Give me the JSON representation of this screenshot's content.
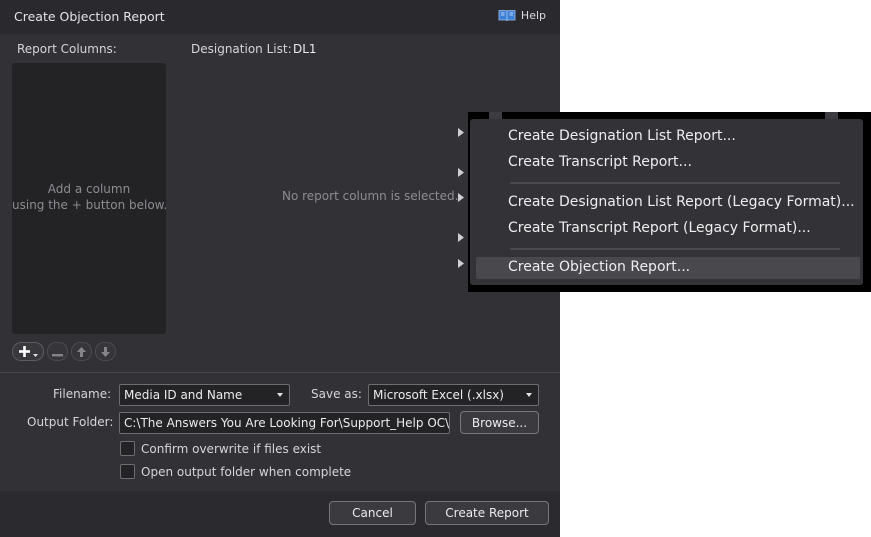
{
  "dialog": {
    "title": "Create Objection Report",
    "help_label": "Help",
    "report_columns_label": "Report Columns:",
    "designation_list_label": "Designation List:",
    "designation_list_value": "DL1",
    "columns_hint_line1": "Add a column",
    "columns_hint_line2": "using the + button below.",
    "no_column_message": "No report column is selected."
  },
  "options": {
    "filename_label": "Filename:",
    "filename_value": "Media ID and Name",
    "save_as_label": "Save as:",
    "save_as_value": "Microsoft Excel (.xlsx)",
    "output_folder_label": "Output Folder:",
    "output_folder_value": "C:\\The Answers You Are Looking For\\Support_Help OC\\_reports",
    "browse_label": "Browse...",
    "confirm_overwrite_label": "Confirm overwrite if files exist",
    "confirm_overwrite_checked": false,
    "open_folder_label": "Open output folder when complete",
    "open_folder_checked": false
  },
  "footer": {
    "cancel_label": "Cancel",
    "create_label": "Create Report"
  },
  "context_menu": {
    "items": [
      {
        "label": "Create Designation List Report..."
      },
      {
        "label": "Create Transcript Report..."
      },
      {
        "label": "Create Designation List Report (Legacy Format)..."
      },
      {
        "label": "Create Transcript Report  (Legacy Format)..."
      },
      {
        "label": "Create Objection Report...",
        "highlighted": true
      }
    ]
  },
  "icons": {
    "help": "book-icon",
    "add": "plus-icon",
    "remove": "minus-icon",
    "move_up": "arrow-up-icon",
    "move_down": "arrow-down-icon",
    "submenu": "chevron-right-icon"
  },
  "colors": {
    "dialog_bg": "#323236",
    "panel_bg": "#232326",
    "help_icon": "#3d7fd6",
    "menu_highlight": "#48484d"
  }
}
